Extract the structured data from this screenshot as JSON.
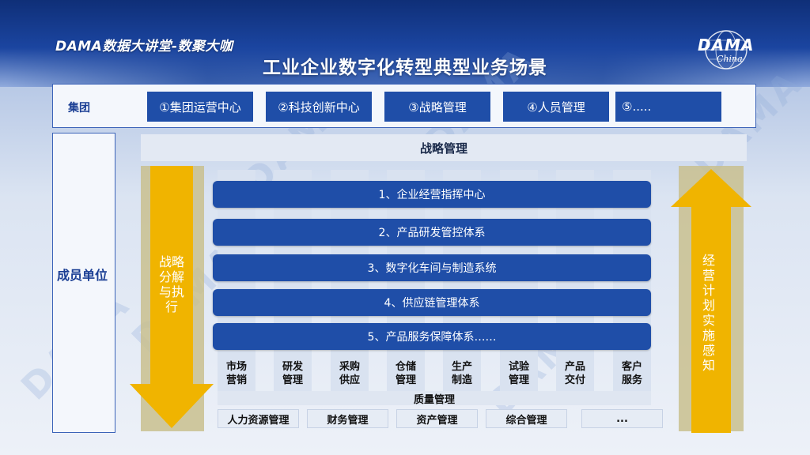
{
  "header": {
    "brand": "DAMA数据大讲堂-数聚大咖",
    "title": "工业企业数字化转型典型业务场景",
    "logo": {
      "word": "DAMA",
      "sub": "China",
      "icon": "globe-icon"
    }
  },
  "group": {
    "label": "集团",
    "items": [
      "①集团运营中心",
      "②科技创新中心",
      "③战略管理",
      "④人员管理",
      "⑤....."
    ]
  },
  "member": {
    "label": "成员单位"
  },
  "strategy": {
    "label": "战略管理"
  },
  "left_arrow": {
    "label": "战略分解与执行",
    "color": "#f0b400"
  },
  "right_arrow": {
    "label": "经营计划实施感知",
    "color": "#f0b400"
  },
  "systems": [
    "1、企业经营指挥中心",
    "2、产品研发管控体系",
    "3、数字化车间与制造系统",
    "4、供应链管理体系",
    "5、产品服务保障体系……"
  ],
  "columns": [
    [
      "市场",
      "营销"
    ],
    [
      "研发",
      "管理"
    ],
    [
      "采购",
      "供应"
    ],
    [
      "仓储",
      "管理"
    ],
    [
      "生产",
      "制造"
    ],
    [
      "试验",
      "管理"
    ],
    [
      "产品",
      "交付"
    ],
    [
      "客户",
      "服务"
    ]
  ],
  "quality": {
    "label": "质量管理"
  },
  "bottom": [
    "人力资源管理",
    "财务管理",
    "资产管理",
    "综合管理",
    "..."
  ],
  "watermark": "DAMA",
  "colors": {
    "accent": "#1f4ea8",
    "arrow": "#f0b400",
    "panel": "#c9bf8e"
  }
}
